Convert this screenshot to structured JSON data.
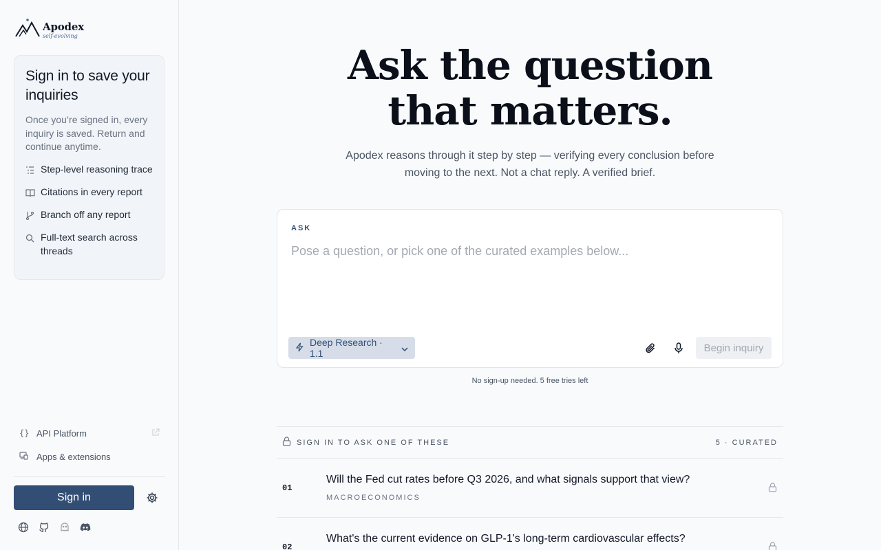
{
  "brand": {
    "name": "Apodex",
    "tagline": "self-evolving"
  },
  "sidebar": {
    "card": {
      "title": "Sign in to save your inquiries",
      "description": "Once you’re signed in, every inquiry is saved. Return and continue anytime.",
      "features": [
        {
          "icon": "list-steps-icon",
          "label": "Step-level reasoning trace"
        },
        {
          "icon": "book-open-icon",
          "label": "Citations in every report"
        },
        {
          "icon": "git-branch-icon",
          "label": "Branch off any report"
        },
        {
          "icon": "search-icon",
          "label": "Full-text search across threads"
        }
      ]
    },
    "links": [
      {
        "icon": "braces-icon",
        "label": "API Platform",
        "external": true
      },
      {
        "icon": "devices-icon",
        "label": "Apps & extensions",
        "external": false
      }
    ],
    "signin_label": "Sign in",
    "social": [
      "globe-icon",
      "github-icon",
      "bot-icon",
      "discord-icon"
    ]
  },
  "hero": {
    "title_line1": "Ask the question",
    "title_line2": "that matters.",
    "subtitle": "Apodex reasons through it step by step — verifying every conclusion before moving to the next. Not a chat reply. A verified brief."
  },
  "ask": {
    "label": "ASK",
    "placeholder": "Pose a question, or pick one of the curated examples below...",
    "value": "",
    "model": "Deep Research · 1.1",
    "begin_label": "Begin inquiry",
    "tries_note": "No sign-up needed. 5 free tries left"
  },
  "examples": {
    "header": "SIGN IN TO ASK ONE OF THESE",
    "count": "5 · CURATED",
    "items": [
      {
        "num": "01",
        "question": "Will the Fed cut rates before Q3 2026, and what signals support that view?",
        "category": "MACROECONOMICS"
      },
      {
        "num": "02",
        "question": "What's the current evidence on GLP-1's long-term cardiovascular effects?",
        "category": ""
      }
    ]
  }
}
